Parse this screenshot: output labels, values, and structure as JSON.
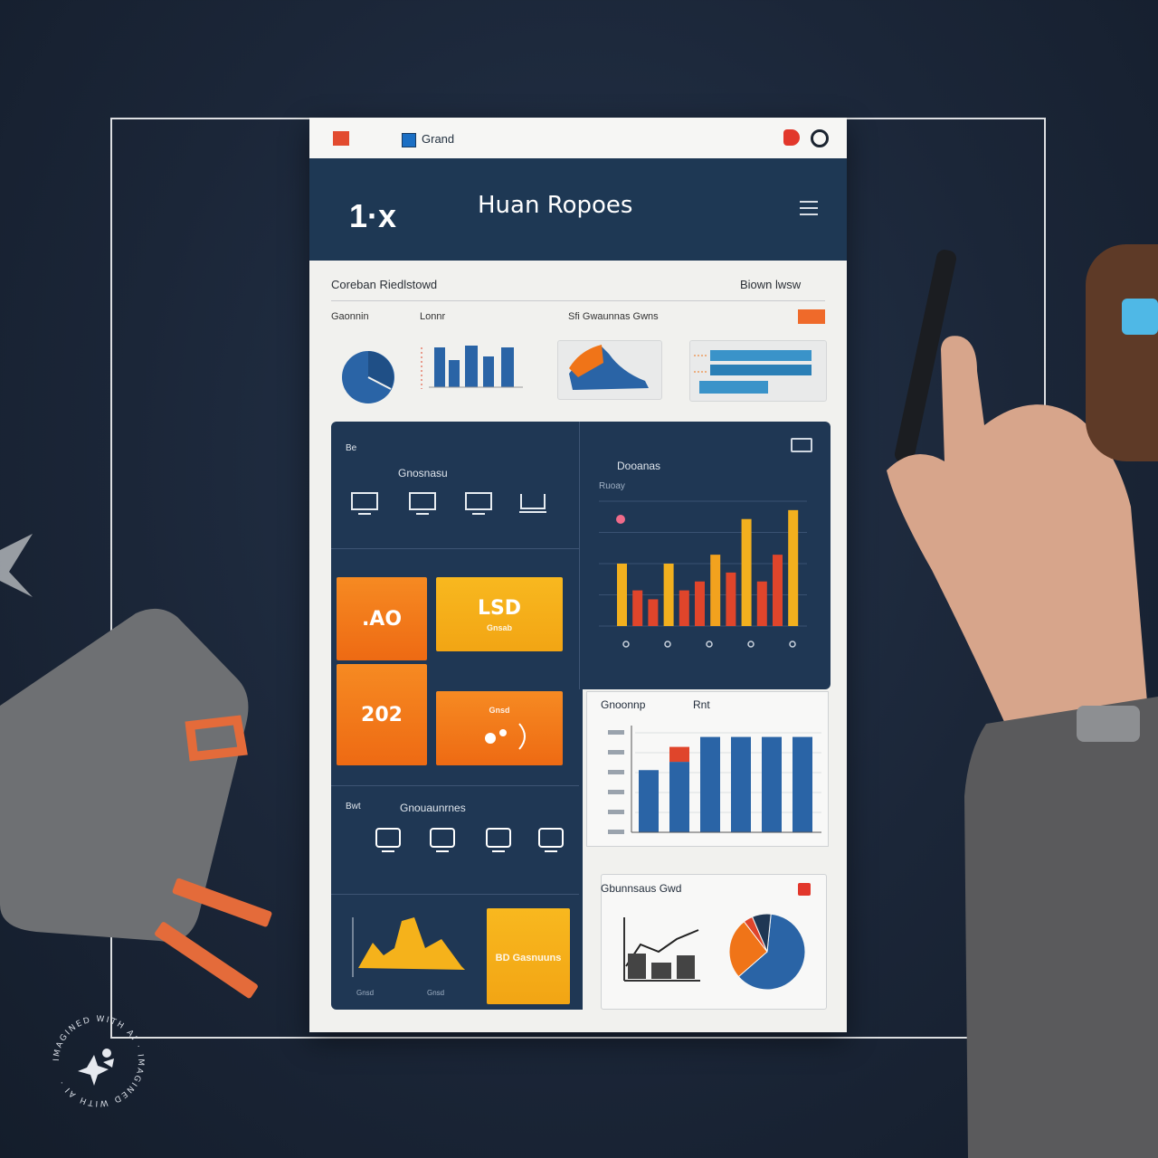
{
  "colors": {
    "background": "#1b2638",
    "navy": "#1f3754",
    "orange": "#f07418",
    "yellow": "#f5b21b",
    "blue": "#2a64a6",
    "red": "#e0452b"
  },
  "topbar": {
    "tab_label": "Grand",
    "icons": [
      "app-icon",
      "tab-icon",
      "s-icon",
      "settings-icon"
    ]
  },
  "header": {
    "logo": "1·x",
    "title": "Huan Ropoes",
    "menu_icon": "hamburger-menu-icon"
  },
  "overview": {
    "title": "Coreban Riedlstowd",
    "action": "Biown lwsw",
    "labels": [
      "Gaonnin",
      "Lonnr",
      "Sfi Gwaunnas Gwns"
    ]
  },
  "panel_left": {
    "tag": "Be",
    "title": "Gnosnasu",
    "kpis": [
      {
        "value": ".AO",
        "caption": ""
      },
      {
        "value": "LSD",
        "caption": "Gnsab"
      },
      {
        "value": "202",
        "caption": ""
      },
      {
        "value": "",
        "caption": "Gnsd"
      }
    ],
    "section2_tag": "Bwt",
    "section2_title": "Gnouaunrnes",
    "yellow_card": "BD Gasnuuns",
    "area_labels": [
      "Gnsd",
      "Gnsd"
    ]
  },
  "panel_right": {
    "title": "Dooanas",
    "subtitle": "Ruoay",
    "icon": "window-icon"
  },
  "chart_data": [
    {
      "type": "bar",
      "title": "",
      "series": [
        {
          "values": [
            7,
            4,
            3,
            7,
            4,
            5,
            8,
            6,
            12,
            5,
            8,
            13
          ]
        }
      ],
      "colors": [
        "#f2b01e",
        "#e0452b",
        "#e0452b",
        "#f2b01e",
        "#e0452b",
        "#e0452b",
        "#f2a21e",
        "#e0452b",
        "#f2b01e",
        "#e0452b",
        "#e0452b",
        "#f2b01e"
      ],
      "grid": true
    },
    {
      "type": "bar",
      "title": "Gnoonnp",
      "subtitle": "Rnt",
      "categories": [
        "",
        "",
        "",
        "",
        "",
        ""
      ],
      "values": [
        7.5,
        8.5,
        11.5,
        11.5,
        11.5,
        11.5
      ],
      "highlight": [
        0,
        1.8,
        0,
        0,
        0,
        0
      ],
      "grid": true
    },
    {
      "type": "pie",
      "title": "Gbunnsaus Gwd",
      "values": [
        62,
        26,
        4,
        8
      ],
      "colors": [
        "#2a64a6",
        "#f07418",
        "#e0452b",
        "#1f3754"
      ]
    }
  ]
}
